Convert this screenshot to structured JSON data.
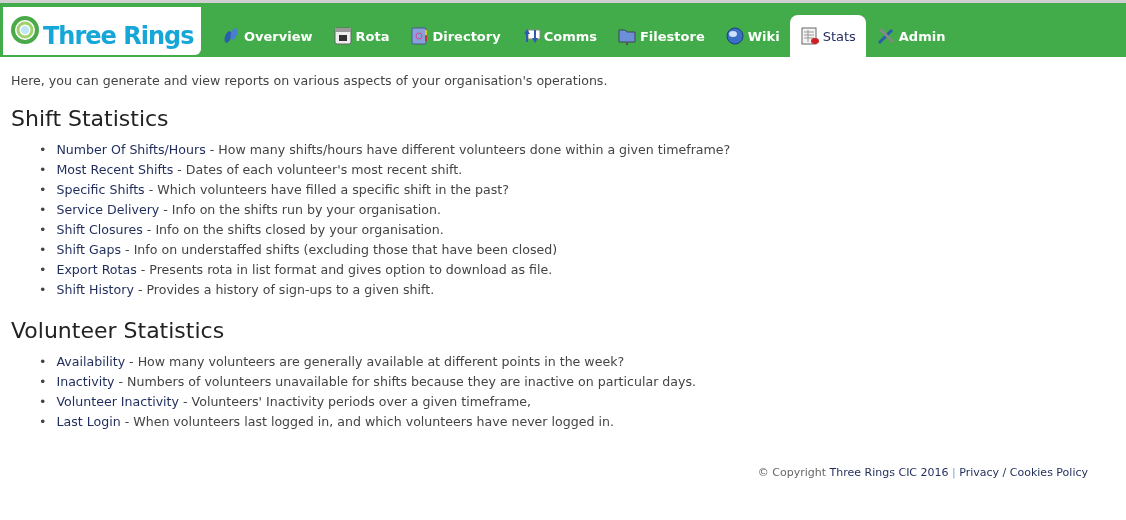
{
  "logo": {
    "text": "Three Rings"
  },
  "tabs": [
    {
      "label": "Overview",
      "selected": false
    },
    {
      "label": "Rota",
      "selected": false
    },
    {
      "label": "Directory",
      "selected": false
    },
    {
      "label": "Comms",
      "selected": false
    },
    {
      "label": "Filestore",
      "selected": false
    },
    {
      "label": "Wiki",
      "selected": false
    },
    {
      "label": "Stats",
      "selected": true
    },
    {
      "label": "Admin",
      "selected": false
    }
  ],
  "intro": "Here, you can generate and view reports on various aspects of your organisation's operations.",
  "sections": [
    {
      "heading": "Shift Statistics",
      "items": [
        {
          "bullet": "•",
          "link": "Number Of Shifts/Hours",
          "description": " - How many shifts/hours have different volunteers done within a given timeframe?"
        },
        {
          "bullet": "•",
          "link": "Most Recent Shifts",
          "description": " - Dates of each volunteer's most recent shift."
        },
        {
          "bullet": "•",
          "link": "Specific Shifts",
          "description": " - Which volunteers have filled a specific shift in the past?"
        },
        {
          "bullet": "•",
          "link": "Service Delivery",
          "description": " - Info on the shifts run by your organisation."
        },
        {
          "bullet": "•",
          "link": "Shift Closures",
          "description": " - Info on the shifts closed by your organisation."
        },
        {
          "bullet": "•",
          "link": "Shift Gaps",
          "description": " - Info on understaffed shifts (excluding those that have been closed)"
        },
        {
          "bullet": "•",
          "link": "Export Rotas",
          "description": " - Presents rota in list format and gives option to download as file."
        },
        {
          "bullet": "•",
          "link": "Shift History",
          "description": " - Provides a history of sign-ups to a given shift."
        }
      ]
    },
    {
      "heading": "Volunteer Statistics",
      "items": [
        {
          "bullet": "•",
          "link": "Availability",
          "description": " - How many volunteers are generally available at different points in the week?"
        },
        {
          "bullet": "•",
          "link": "Inactivity",
          "description": " - Numbers of volunteers unavailable for shifts because they are inactive on particular days."
        },
        {
          "bullet": "•",
          "link": "Volunteer Inactivity",
          "description": " - Volunteers' Inactivity periods over a given timeframe,"
        },
        {
          "bullet": "•",
          "link": "Last Login",
          "description": " - When volunteers last logged in, and which volunteers have never logged in."
        }
      ]
    }
  ],
  "footer": {
    "copyright": "© Copyright ",
    "owner": "Three Rings CIC 2016",
    "separator": "|",
    "privacy": "Privacy / Cookies Policy"
  }
}
